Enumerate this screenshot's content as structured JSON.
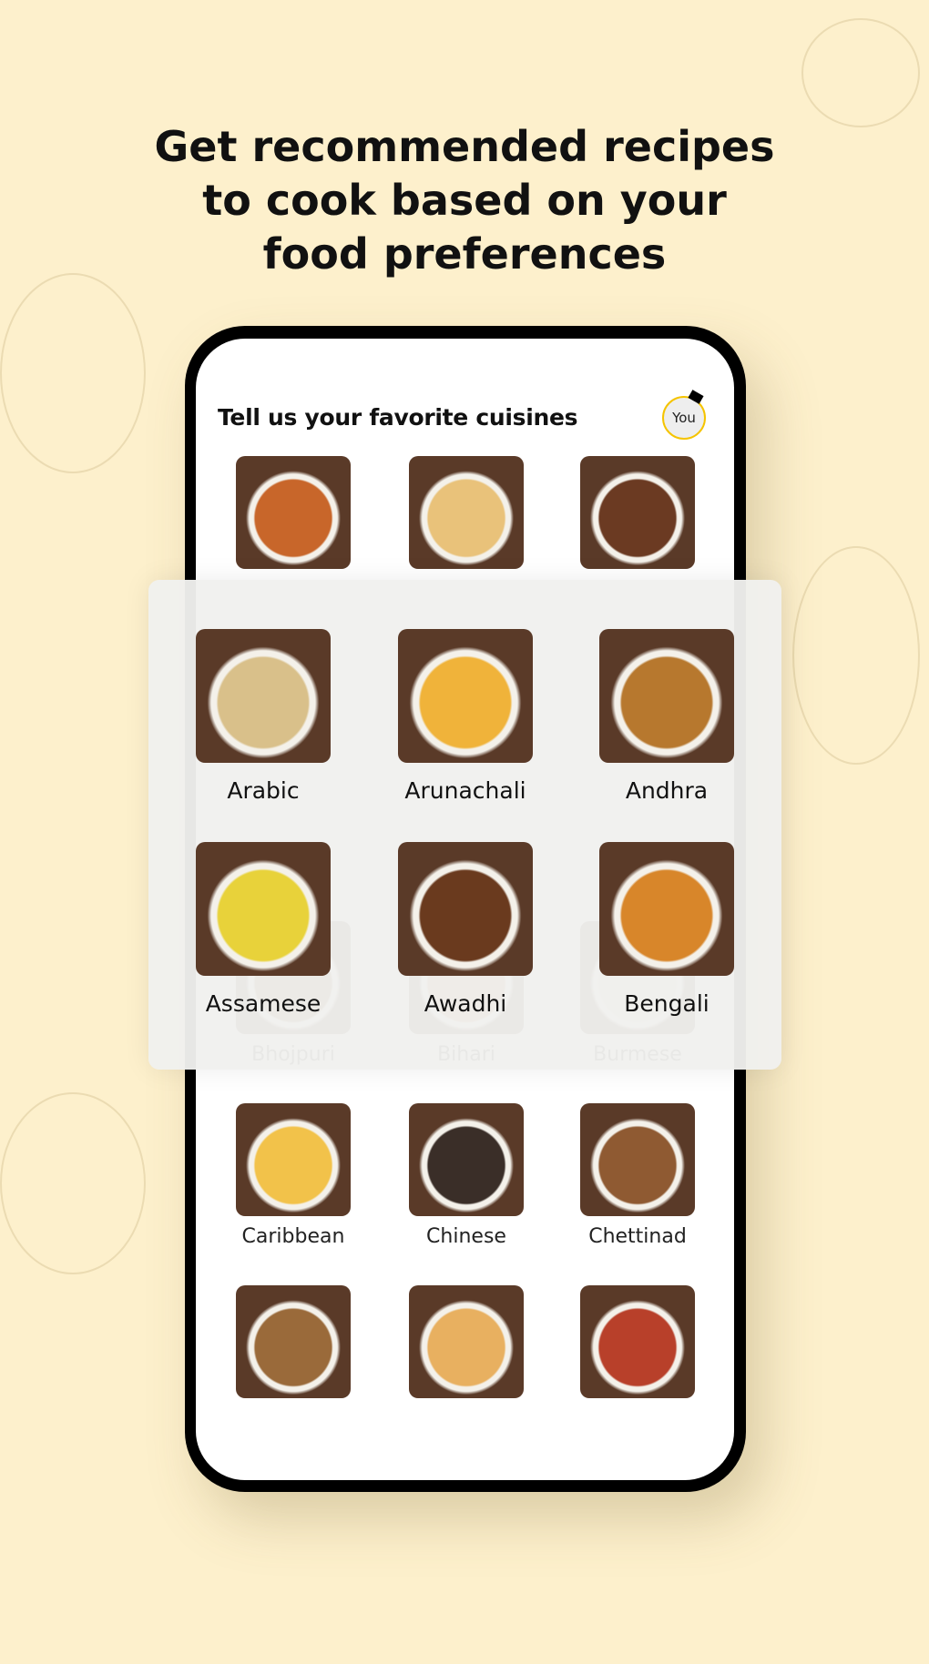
{
  "headline": [
    "Get recommended recipes",
    "to cook based on your",
    "food preferences"
  ],
  "screen": {
    "title": "Tell us your favorite cuisines",
    "avatar_label": "You"
  },
  "top_row": [
    {
      "label": "",
      "color": "#c8662a"
    },
    {
      "label": "",
      "color": "#e9c27a"
    },
    {
      "label": "",
      "color": "#6b3a22"
    }
  ],
  "highlighted": [
    {
      "label": "Arabic",
      "color": "#d9c08a"
    },
    {
      "label": "Arunachali",
      "color": "#f0b33a"
    },
    {
      "label": "Andhra",
      "color": "#b7782e"
    },
    {
      "label": "Assamese",
      "color": "#e8d23a"
    },
    {
      "label": "Awadhi",
      "color": "#6a3a1e"
    },
    {
      "label": "Bengali",
      "color": "#d8862a"
    }
  ],
  "rows": [
    [
      {
        "label": "Bhojpuri",
        "color": "#8a5a2a"
      },
      {
        "label": "Bihari",
        "color": "#c9854a"
      },
      {
        "label": "Burmese",
        "color": "#e4dccb"
      }
    ],
    [
      {
        "label": "Caribbean",
        "color": "#f2c24a"
      },
      {
        "label": "Chinese",
        "color": "#3a2e28"
      },
      {
        "label": "Chettinad",
        "color": "#8f5a32"
      }
    ],
    [
      {
        "label": "",
        "color": "#9a6a3a"
      },
      {
        "label": "",
        "color": "#e8b060"
      },
      {
        "label": "",
        "color": "#b8402a"
      }
    ]
  ]
}
